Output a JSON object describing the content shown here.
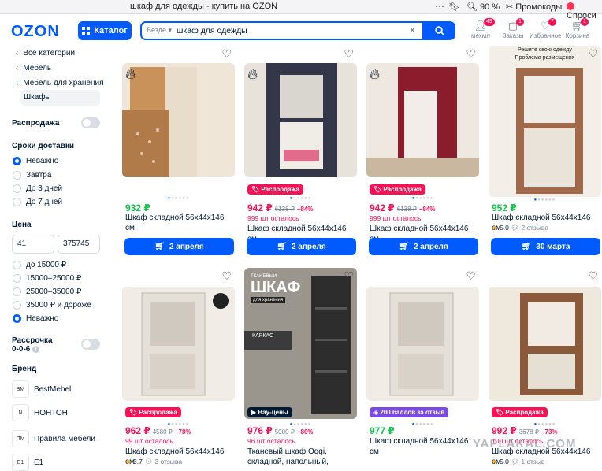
{
  "browser": {
    "title": "шкаф для одежды - купить на OZON",
    "zoom": "90 %",
    "promo": "Промокоды",
    "ask": "Спроси"
  },
  "header": {
    "logo": "OZON",
    "catalog_label": "Каталог",
    "search_scope": "Везде",
    "search_value": "шкаф для одежды",
    "icons": [
      {
        "label": "мехмл",
        "badge": "49",
        "icon": "user-icon"
      },
      {
        "label": "Заказы",
        "badge": "1",
        "icon": "box-icon"
      },
      {
        "label": "Избранное",
        "badge": "7",
        "icon": "heart-icon"
      },
      {
        "label": "Корзина",
        "badge": "1",
        "icon": "cart-icon"
      }
    ]
  },
  "sidebar": {
    "breadcrumbs": [
      "Все категории",
      "Мебель",
      "Мебель для хранения"
    ],
    "active_category": "Шкафы",
    "sale_label": "Распродажа",
    "delivery": {
      "title": "Сроки доставки",
      "options": [
        "Неважно",
        "Завтра",
        "До 3 дней",
        "До 7 дней"
      ],
      "selected": 0
    },
    "price": {
      "title": "Цена",
      "min": "41",
      "max": "375745",
      "options": [
        "до 15000 ₽",
        "15000–25000 ₽",
        "25000–35000 ₽",
        "35000 ₽ и дороже",
        "Неважно"
      ],
      "selected": 4
    },
    "installment": {
      "title": "Рассрочка",
      "subtitle": "0-0-6"
    },
    "brand_title": "Бренд",
    "brands": [
      {
        "name": "BestMebel",
        "logo": "BM"
      },
      {
        "name": "НОНТОН",
        "logo": "N"
      },
      {
        "name": "Правила мебели",
        "logo": "ПМ"
      },
      {
        "name": "E1",
        "logo": "E1"
      }
    ]
  },
  "products": [
    {
      "price": "932 ₽",
      "sale": false,
      "name": "Шкаф складной 56х44х146 см",
      "delivery": "2 апреля",
      "fire": true,
      "image_color": "#c9925a"
    },
    {
      "badge": "Распродажа",
      "badge_color": "#f91155",
      "price": "942 ₽",
      "sale": true,
      "old": "6138 ₽",
      "disc": "−84%",
      "left": "999 шт осталось",
      "name": "Шкаф складной 56х44х146 см",
      "delivery": "2 апреля",
      "fire": true,
      "image_color": "#34364a"
    },
    {
      "badge": "Распродажа",
      "badge_color": "#f91155",
      "price": "942 ₽",
      "sale": true,
      "old": "6138 ₽",
      "disc": "−84%",
      "left": "999 шт осталось",
      "name": "Шкаф складной 56х44х146 см",
      "delivery": "2 апреля",
      "fire": true,
      "image_color": "#8a1c2c"
    },
    {
      "price": "952 ₽",
      "sale": false,
      "name": "Шкаф складной 56х44х146 см",
      "rating": "5.0",
      "reviews": "2 отзыва",
      "delivery": "30 марта",
      "image_color": "#a0694a",
      "caption1": "Решите свою одежду",
      "caption2": "Проблема размещения"
    },
    {
      "badge": "Распродажа",
      "badge_color": "#f91155",
      "price": "962 ₽",
      "sale": true,
      "old": "4580 ₽",
      "disc": "−78%",
      "left": "99 шт осталось",
      "name": "Шкаф складной 56х44х146 см",
      "rating": "3.7",
      "reviews": "3 отзыва",
      "image_color": "#e4e0d8"
    },
    {
      "badge": "Вау-цены",
      "badge_color": "#001a34",
      "price": "976 ₽",
      "sale": true,
      "old": "5000 ₽",
      "disc": "−80%",
      "left": "96 шт осталось",
      "name": "Тканевый шкаф Oqqi, складной, напольный, модульный стеллаж...",
      "image_color": "#2d2d2d",
      "caption1": "ТКАНЕВЫЙ",
      "caption2": "ШКАФ",
      "caption3": "для хранения",
      "caption4": "КАРКАС"
    },
    {
      "badge": "200 баллов за отзыв",
      "badge_color": "#7a4ae2",
      "price": "977 ₽",
      "sale": false,
      "name": "Шкаф складной 56х44х146 см",
      "image_color": "#e4e0d8"
    },
    {
      "badge": "Распродажа",
      "badge_color": "#f91155",
      "price": "992 ₽",
      "sale": true,
      "old": "3678 ₽",
      "disc": "−73%",
      "left": "100 шт осталось",
      "name": "Шкаф складной 56х44х146 см",
      "rating": "5.0",
      "reviews": "1 отзыв",
      "image_color": "#8a5a3a"
    }
  ],
  "watermark": "YAPLAKAL.COM"
}
